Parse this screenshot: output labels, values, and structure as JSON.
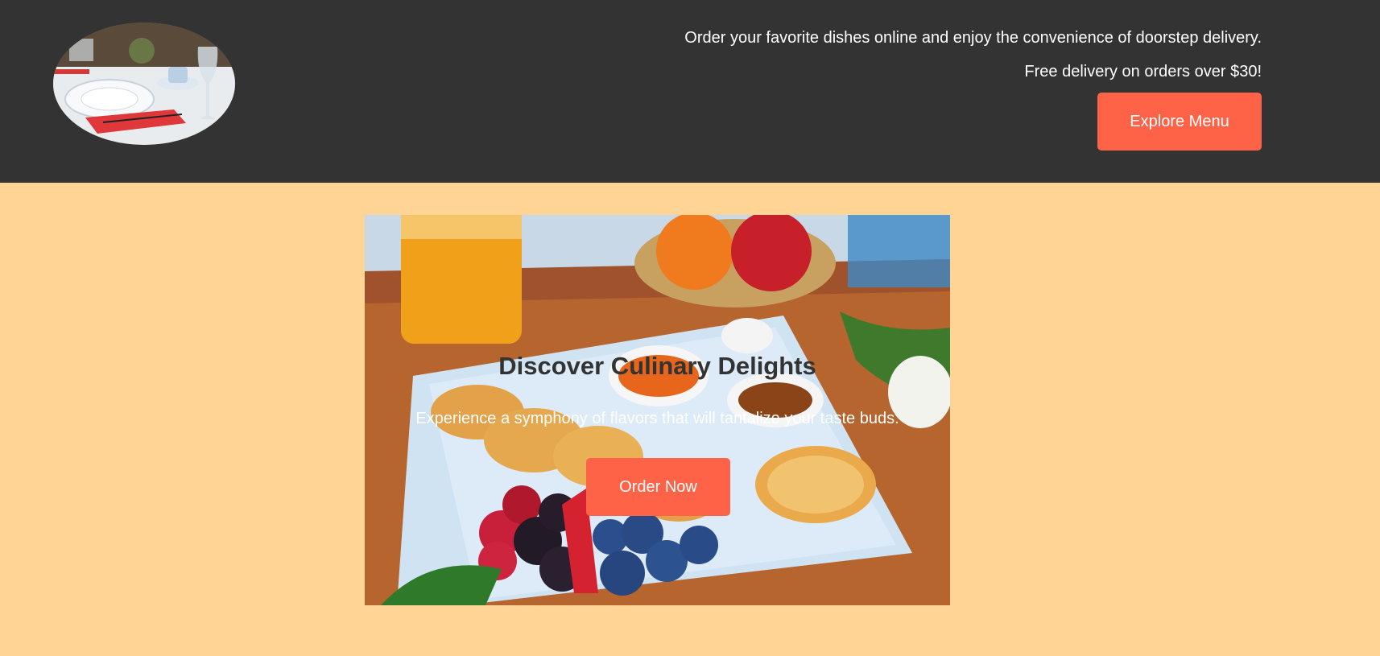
{
  "header": {
    "tagline": "Order your favorite dishes online and enjoy the convenience of doorstep delivery.",
    "promo": "Free delivery on orders over $30!",
    "explore_label": "Explore Menu"
  },
  "hero": {
    "title": "Discover Culinary Delights",
    "subtitle": "Experience a symphony of flavors that will tantalize your taste buds.",
    "order_label": "Order Now"
  },
  "colors": {
    "header_bg": "#333333",
    "page_bg": "#ffd494",
    "accent": "#ff6347"
  }
}
